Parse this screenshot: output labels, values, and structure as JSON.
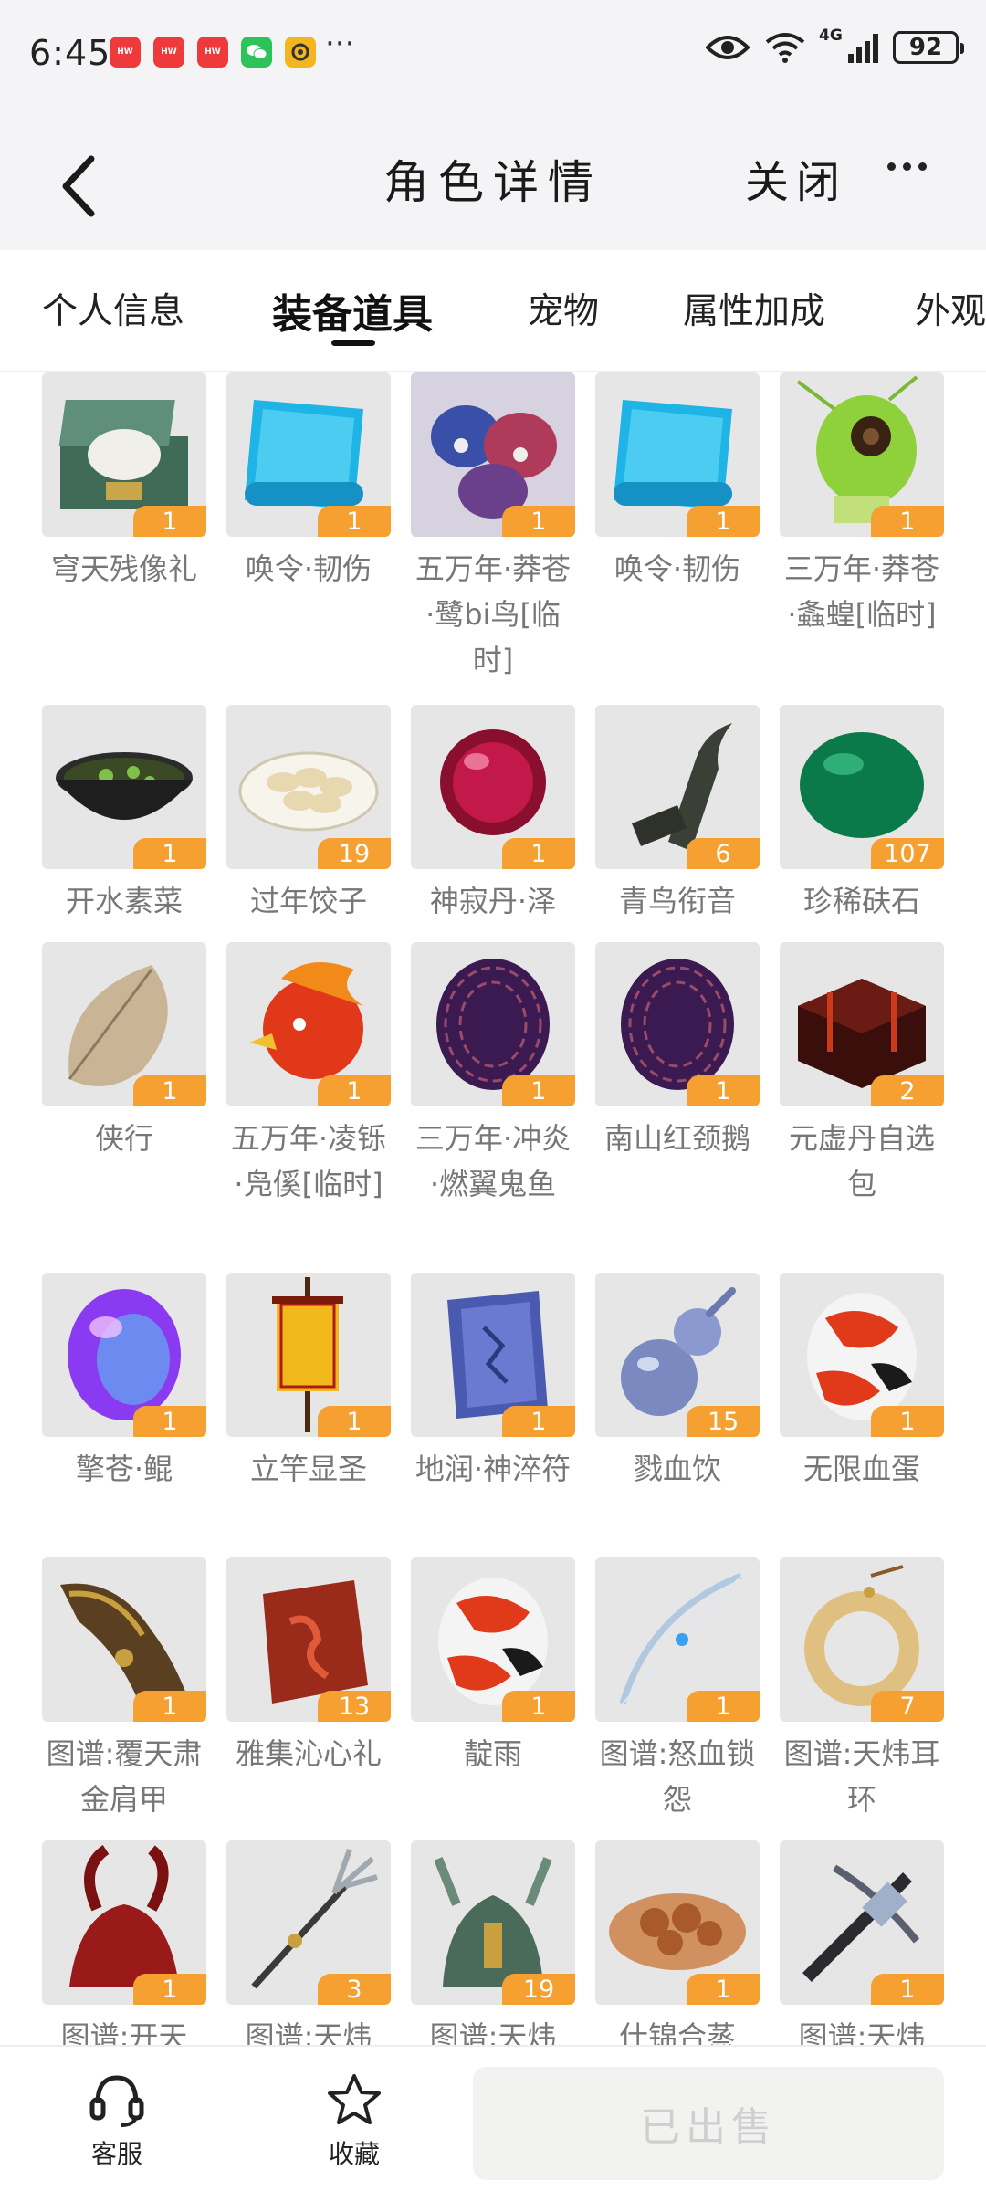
{
  "status": {
    "time": "6:45",
    "battery": "92",
    "network": "4G",
    "apps": [
      {
        "name": "huawei-mall-icon",
        "color": "#ee3a3a"
      },
      {
        "name": "huawei-mall-icon",
        "color": "#ee3a3a"
      },
      {
        "name": "huawei-mall-icon",
        "color": "#ee3a3a"
      },
      {
        "name": "wechat-icon",
        "color": "#2ec35a"
      },
      {
        "name": "app-icon",
        "color": "#f3b61f"
      }
    ],
    "more": "···"
  },
  "header": {
    "title": "角色详情",
    "close_label": "关闭"
  },
  "tabs": [
    {
      "label": "个人信息",
      "active": false
    },
    {
      "label": "装备道具",
      "active": true
    },
    {
      "label": "宠物",
      "active": false
    },
    {
      "label": "属性加成",
      "active": false
    },
    {
      "label": "外观",
      "active": false
    }
  ],
  "items": [
    {
      "name": "穹天残像礼",
      "count": "1",
      "icon": "green-treasure-chest"
    },
    {
      "name": "唤令·韧伤",
      "count": "1",
      "icon": "blue-scroll"
    },
    {
      "name": "五万年·莽苍·鹭bi鸟[临时]",
      "count": "1",
      "icon": "blue-birds"
    },
    {
      "name": "唤令·韧伤",
      "count": "1",
      "icon": "blue-scroll"
    },
    {
      "name": "三万年·莽苍·螽蝗[临时]",
      "count": "1",
      "icon": "green-grasshopper"
    },
    {
      "name": "开水素菜",
      "count": "1",
      "icon": "vegetable-soup-bowl"
    },
    {
      "name": "过年饺子",
      "count": "19",
      "icon": "dumplings-plate"
    },
    {
      "name": "神寂丹·泽",
      "count": "1",
      "icon": "red-pill-orb"
    },
    {
      "name": "青鸟衔音",
      "count": "6",
      "icon": "bird-whistle"
    },
    {
      "name": "珍稀砆石",
      "count": "107",
      "icon": "jade-stone"
    },
    {
      "name": "侠行",
      "count": "1",
      "icon": "dry-leaf"
    },
    {
      "name": "五万年·凌铄·凫傒[临时]",
      "count": "1",
      "icon": "fire-bird-head"
    },
    {
      "name": "三万年·冲炎·燃翼鬼鱼",
      "count": "1",
      "icon": "scaled-egg"
    },
    {
      "name": "南山红颈鹅",
      "count": "1",
      "icon": "scaled-egg"
    },
    {
      "name": "元虚丹自选包",
      "count": "2",
      "icon": "lacquer-box"
    },
    {
      "name": "擎苍·鲲",
      "count": "1",
      "icon": "purple-egg"
    },
    {
      "name": "立竿显圣",
      "count": "1",
      "icon": "banner-flag"
    },
    {
      "name": "地润·神淬符",
      "count": "1",
      "icon": "rune-book"
    },
    {
      "name": "戮血饮",
      "count": "15",
      "icon": "gourd"
    },
    {
      "name": "无限血蛋",
      "count": "1",
      "icon": "koi-egg"
    },
    {
      "name": "图谱:覆天肃金肩甲",
      "count": "1",
      "icon": "armor-shoulder"
    },
    {
      "name": "雅集沁心礼",
      "count": "13",
      "icon": "red-seal-stone"
    },
    {
      "name": "靛雨",
      "count": "1",
      "icon": "koi-egg"
    },
    {
      "name": "图谱:怒血锁怨",
      "count": "1",
      "icon": "silver-bow"
    },
    {
      "name": "图谱:天炜耳环",
      "count": "7",
      "icon": "jade-ring"
    },
    {
      "name": "图谱:开天",
      "count": "1",
      "icon": "red-horned-helmet"
    },
    {
      "name": "图谱:天炜",
      "count": "3",
      "icon": "trident-spear"
    },
    {
      "name": "图谱:天炜",
      "count": "19",
      "icon": "bronze-helmet"
    },
    {
      "name": "什锦合蒸",
      "count": "1",
      "icon": "pastry-plate"
    },
    {
      "name": "图谱:天炜",
      "count": "1",
      "icon": "crossbow"
    }
  ],
  "bottom": {
    "service_label": "客服",
    "favorite_label": "收藏",
    "sold_label": "已出售"
  },
  "colors": {
    "badge": "#f5a031",
    "header_bg": "#f4f4f6",
    "item_text": "#777777"
  }
}
